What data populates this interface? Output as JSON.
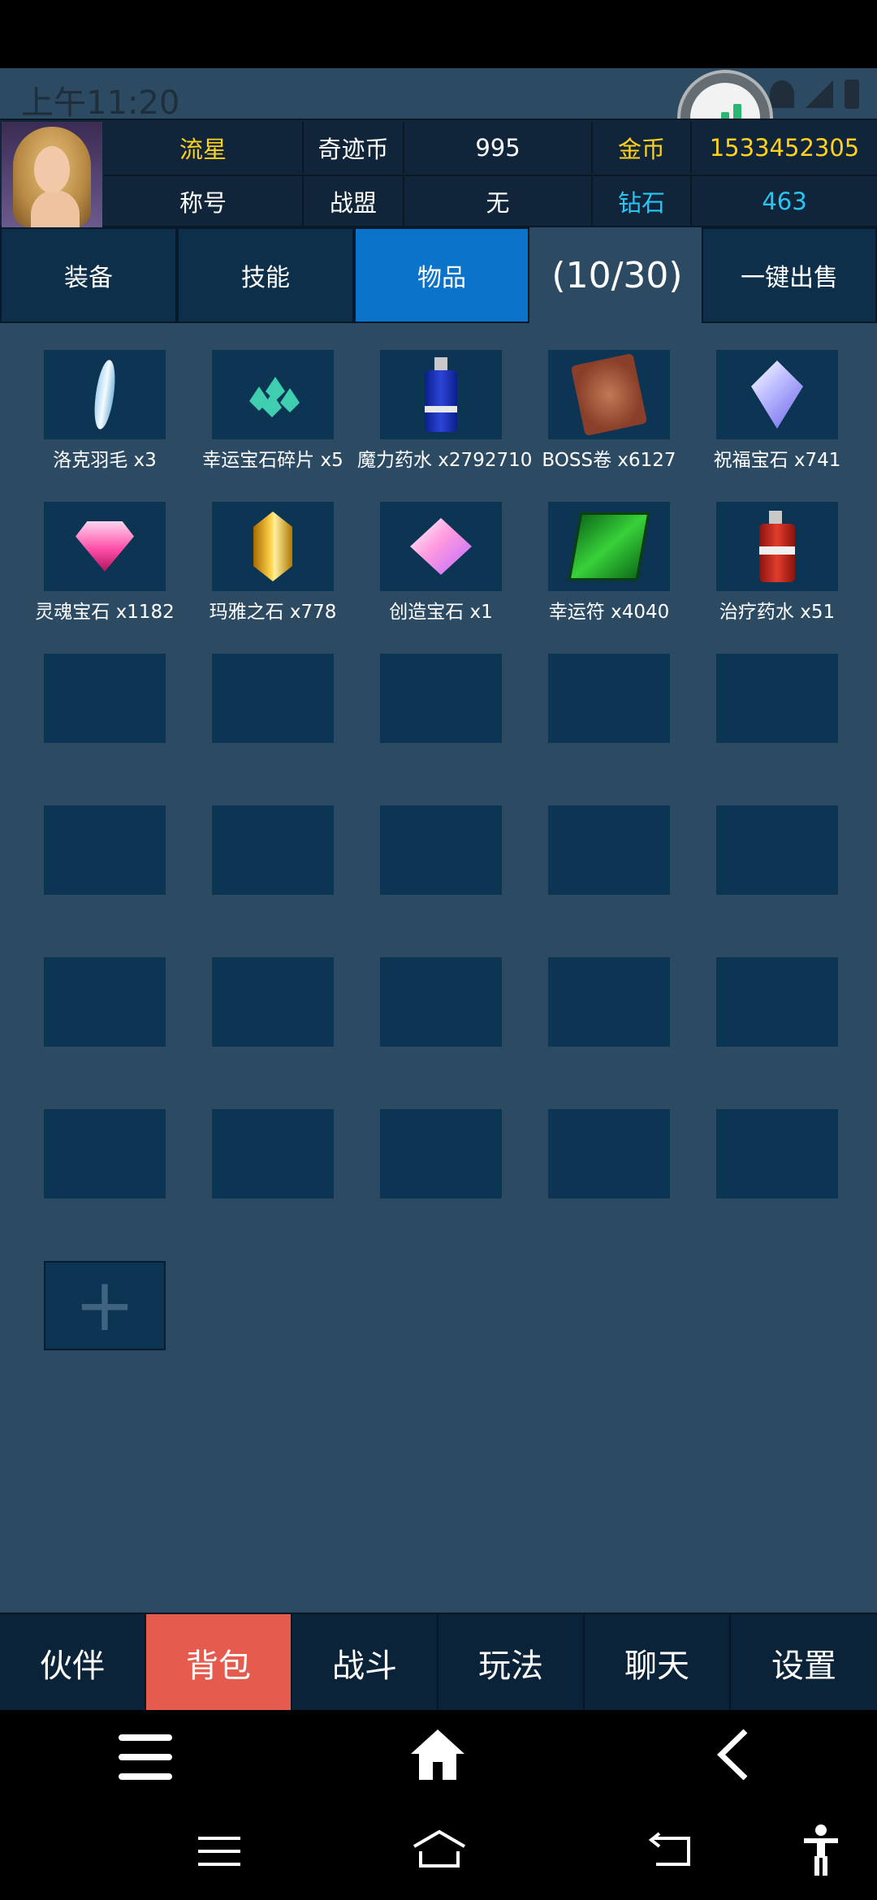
{
  "status_bar": {
    "time": "上午11:20"
  },
  "player": {
    "name": "流星",
    "currency_label": "奇迹币",
    "currency_value": "995",
    "gold_label": "金币",
    "gold_value": "1533452305",
    "title_label": "称号",
    "alliance_label": "战盟",
    "alliance_value": "无",
    "diamond_label": "钻石",
    "diamond_value": "463"
  },
  "tabs": [
    {
      "label": "装备"
    },
    {
      "label": "技能"
    },
    {
      "label": "物品",
      "active": true
    }
  ],
  "inventory": {
    "count": "(10/30)",
    "sell_all_label": "一键出售",
    "items": [
      {
        "label": "洛克羽毛 x3",
        "icon": "feather-icon"
      },
      {
        "label": "幸运宝石碎片 x5",
        "icon": "gem-shards-icon"
      },
      {
        "label": "魔力药水 x2792710",
        "icon": "blue-potion-icon"
      },
      {
        "label": "BOSS卷 x6127",
        "icon": "boss-scroll-icon"
      },
      {
        "label": "祝福宝石 x741",
        "icon": "blessing-gem-icon"
      },
      {
        "label": "灵魂宝石 x1182",
        "icon": "soul-gem-icon"
      },
      {
        "label": "玛雅之石 x778",
        "icon": "maya-stone-icon"
      },
      {
        "label": "创造宝石 x1",
        "icon": "creation-gem-icon"
      },
      {
        "label": "幸运符 x4040",
        "icon": "luck-charm-icon"
      },
      {
        "label": "治疗药水 x51",
        "icon": "red-potion-icon"
      }
    ],
    "add_slot_symbol": "+"
  },
  "bottom_nav": [
    {
      "label": "伙伴"
    },
    {
      "label": "背包",
      "active": true
    },
    {
      "label": "战斗"
    },
    {
      "label": "玩法"
    },
    {
      "label": "聊天"
    },
    {
      "label": "设置"
    }
  ],
  "colors": {
    "background": "#2c4b63",
    "active_tab": "#0b73c9",
    "active_nav": "#e55b4d",
    "gold_text": "#ffd21e",
    "diamond_text": "#29c6f5"
  }
}
